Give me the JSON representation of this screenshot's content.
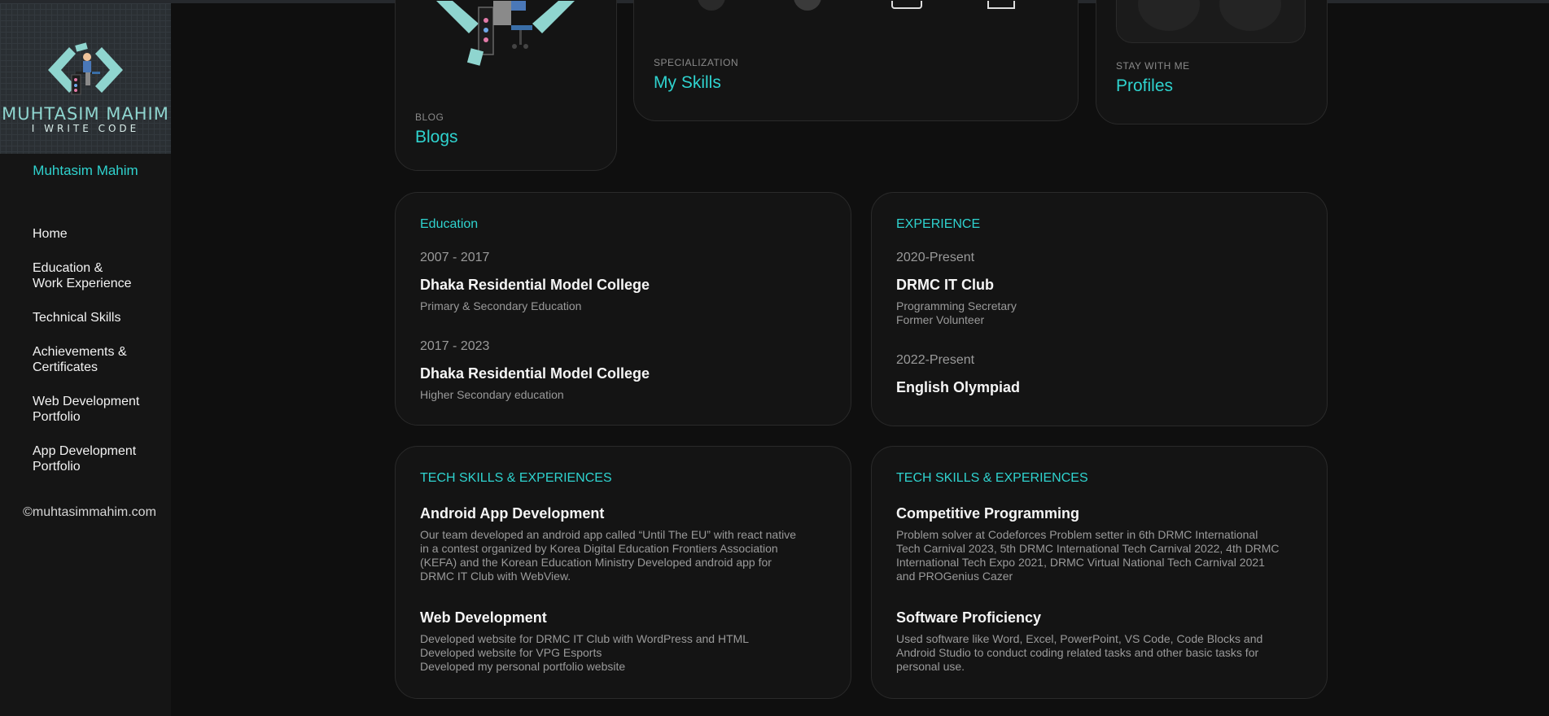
{
  "sidebar": {
    "logo_name": "MUHTASIM MAHIM",
    "logo_tagline": "I WRITE CODE",
    "name": "Muhtasim Mahim",
    "nav": [
      {
        "line1": "Home",
        "line2": ""
      },
      {
        "line1": "Education &",
        "line2": "Work Experience"
      },
      {
        "line1": "Technical Skills",
        "line2": ""
      },
      {
        "line1": "Achievements &",
        "line2": "Certificates"
      },
      {
        "line1": "Web Development",
        "line2": "Portfolio"
      },
      {
        "line1": "App Development",
        "line2": "Portfolio"
      }
    ],
    "copyright": "©muhtasimmahim.com"
  },
  "top_cards": {
    "blog": {
      "label": "BLOG",
      "title": "Blogs"
    },
    "skills": {
      "label": "SPECIALIZATION",
      "title": "My Skills"
    },
    "profiles": {
      "label": "STAY WITH ME",
      "title": "Profiles"
    }
  },
  "education": {
    "title": "Education",
    "items": [
      {
        "years": "2007 - 2017",
        "institution": "Dhaka Residential Model College",
        "detail": "Primary & Secondary Education"
      },
      {
        "years": "2017 - 2023",
        "institution": "Dhaka Residential Model College",
        "detail": "Higher Secondary education"
      }
    ]
  },
  "experience": {
    "title": "EXPERIENCE",
    "items": [
      {
        "years": "2020-Present",
        "org": "DRMC IT Club",
        "role1": "Programming Secretary",
        "role2": "Former Volunteer"
      },
      {
        "years": "2022-Present",
        "org": "English Olympiad"
      }
    ]
  },
  "tech_left": {
    "title": "TECH SKILLS & EXPERIENCES",
    "items": [
      {
        "heading": "Android App Development",
        "lines": [
          "Our team developed an android app called “Until The EU” with react native",
          "in a contest organized by Korea Digital Education Frontiers Association",
          "(KEFA) and the Korean Education Ministry Developed android app for",
          "DRMC IT Club with WebView."
        ]
      },
      {
        "heading": "Web Development",
        "lines": [
          "Developed website for DRMC IT Club with WordPress and HTML",
          "Developed website for VPG Esports",
          "Developed my personal portfolio website"
        ]
      }
    ]
  },
  "tech_right": {
    "title": "TECH SKILLS & EXPERIENCES",
    "items": [
      {
        "heading": "Competitive Programming",
        "lines": [
          "Problem solver at Codeforces Problem setter in 6th DRMC International",
          "Tech Carnival 2023, 5th DRMC International Tech Carnival 2022, 4th DRMC",
          "International Tech Expo 2021, DRMC Virtual National Tech Carnival 2021",
          "and PROGenius Cazer"
        ]
      },
      {
        "heading": "Software Proficiency",
        "lines": [
          "Used software like Word, Excel, PowerPoint, VS Code, Code Blocks and",
          "Android Studio to conduct coding related tasks and other basic tasks for",
          "personal use."
        ]
      }
    ]
  },
  "colors": {
    "accent": "#2fd3cf",
    "background": "#0f0f0f",
    "card": "#141414"
  }
}
